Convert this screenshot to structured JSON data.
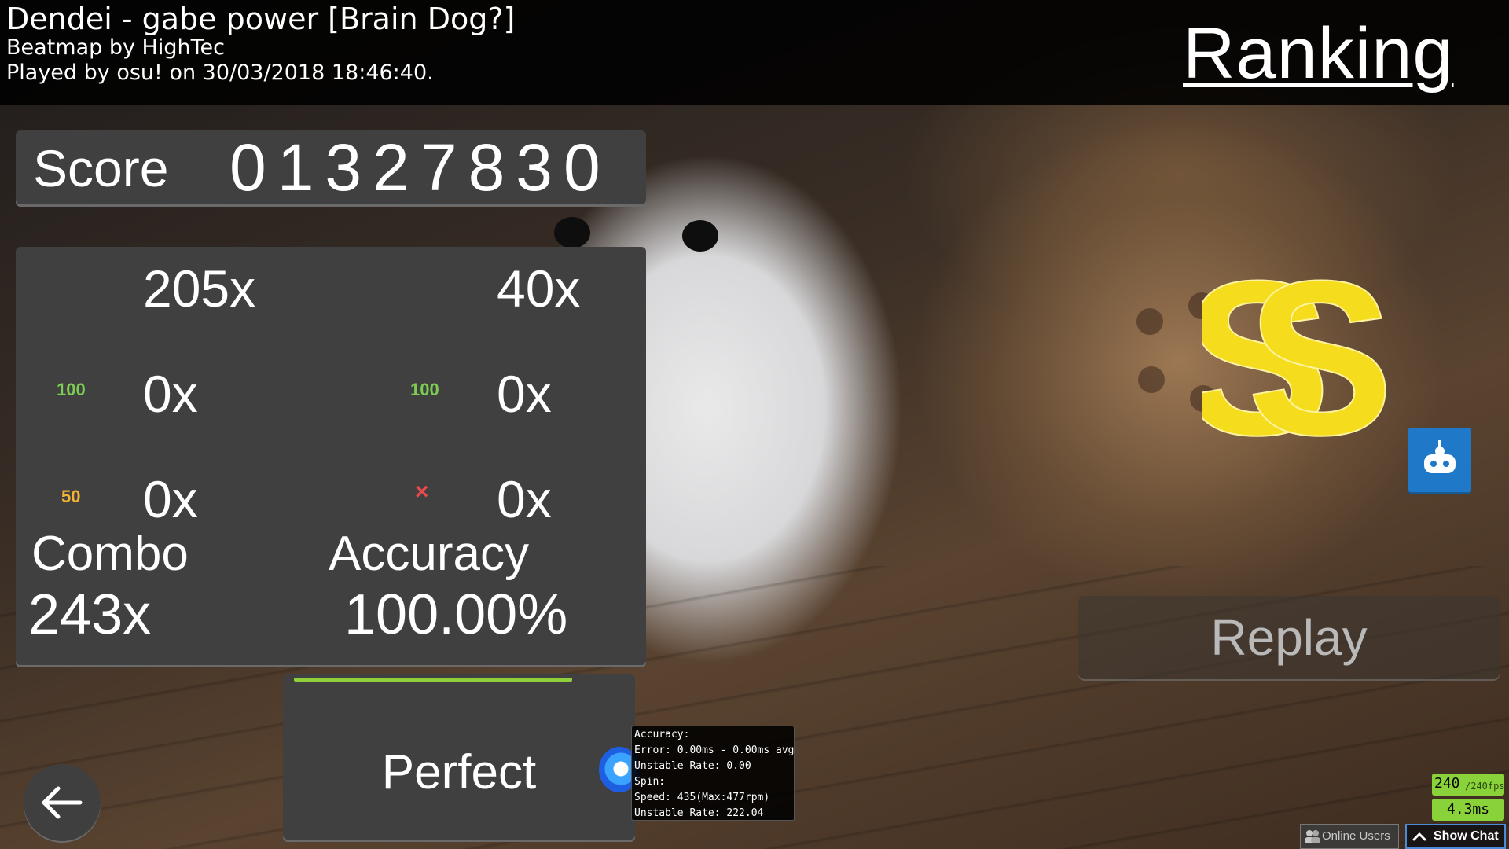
{
  "header": {
    "song_title": "Dendei - gabe power [Brain Dog?]",
    "beatmap_by": "Beatmap by HighTec",
    "played_by": "Played by osu! on 30/03/2018 18:46:40.",
    "ranking_title": "Ranking"
  },
  "score": {
    "label": "Score",
    "value": "01327830"
  },
  "hits": {
    "count_300": "205x",
    "count_geki": "40x",
    "icon_100": "100",
    "count_100": "0x",
    "icon_katu": "100",
    "count_katu": "0x",
    "icon_50": "50",
    "count_50": "0x",
    "icon_miss": "×",
    "count_miss": "0x"
  },
  "combo": {
    "label": "Combo",
    "value": "243x"
  },
  "accuracy": {
    "label": "Accuracy",
    "value": "100.00%"
  },
  "perfect": {
    "label": "Perfect"
  },
  "grade": "SS",
  "replay_label": "Replay",
  "tooltip": {
    "lines": [
      "Accuracy:",
      "Error: 0.00ms - 0.00ms avg",
      "Unstable Rate: 0.00",
      "Spin:",
      "Speed: 435(Max:477rpm)",
      "Unstable Rate: 222.04"
    ]
  },
  "fps": {
    "value": "240",
    "target": "/240fps",
    "frametime": "4.3ms"
  },
  "bottom_bar": {
    "online_users": "Online Users",
    "show_chat": "Show Chat"
  },
  "colors": {
    "grade_yellow": "#f5dd1e",
    "hit_100": "#7ccc54",
    "hit_50": "#f2b233",
    "hit_miss": "#e84b4b",
    "auto_button": "#1f78c8",
    "perfect_bar": "#8fcf3a",
    "fps_green": "#8ad23a"
  }
}
